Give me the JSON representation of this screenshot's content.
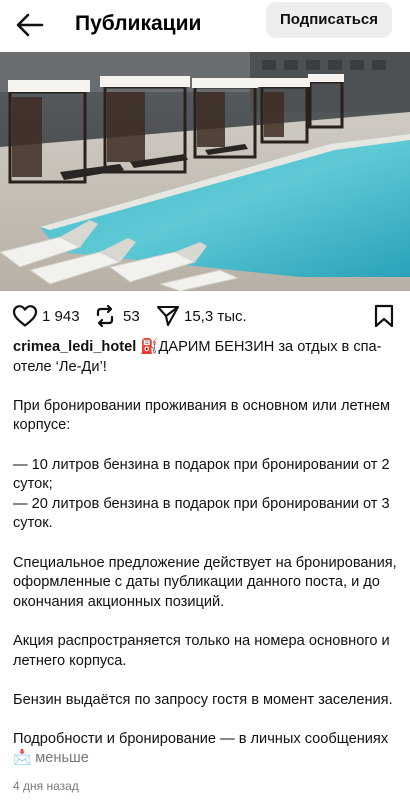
{
  "header": {
    "title": "Публикации",
    "subscribe_label": "Подписаться"
  },
  "post": {
    "likes": "1 943",
    "reposts": "53",
    "shares": "15,3 тыс.",
    "username": "crimea_ledi_hotel",
    "caption_first": "⛽ДАРИМ БЕНЗИН за отдых в спа-отеле ‘Ле-Ди’!",
    "caption_p1": "При бронировании проживания в основном или летнем корпусе:",
    "caption_p2a": "— 10 литров бензина в подарок при бронировании от 2 суток;",
    "caption_p2b": "— 20 литров бензина в подарок при бронировании от 3 суток.",
    "caption_p3": "Специальное предложение действует на бронирования, оформленные с даты публикации данного поста, и до окончания акционных позиций.",
    "caption_p4": "Акция распространяется только на номера основного и летнего корпуса.",
    "caption_p5": "Бензин выдаётся по запросу гостя в момент заселения.",
    "caption_p6": "Подробности и бронирование — в личных сообщениях 📩",
    "less_label": "меньше",
    "date": "4 дня назад"
  },
  "icons": {
    "back": "arrow-left-icon",
    "like": "heart-icon",
    "repost": "repost-icon",
    "share": "send-icon",
    "save": "bookmark-icon"
  }
}
